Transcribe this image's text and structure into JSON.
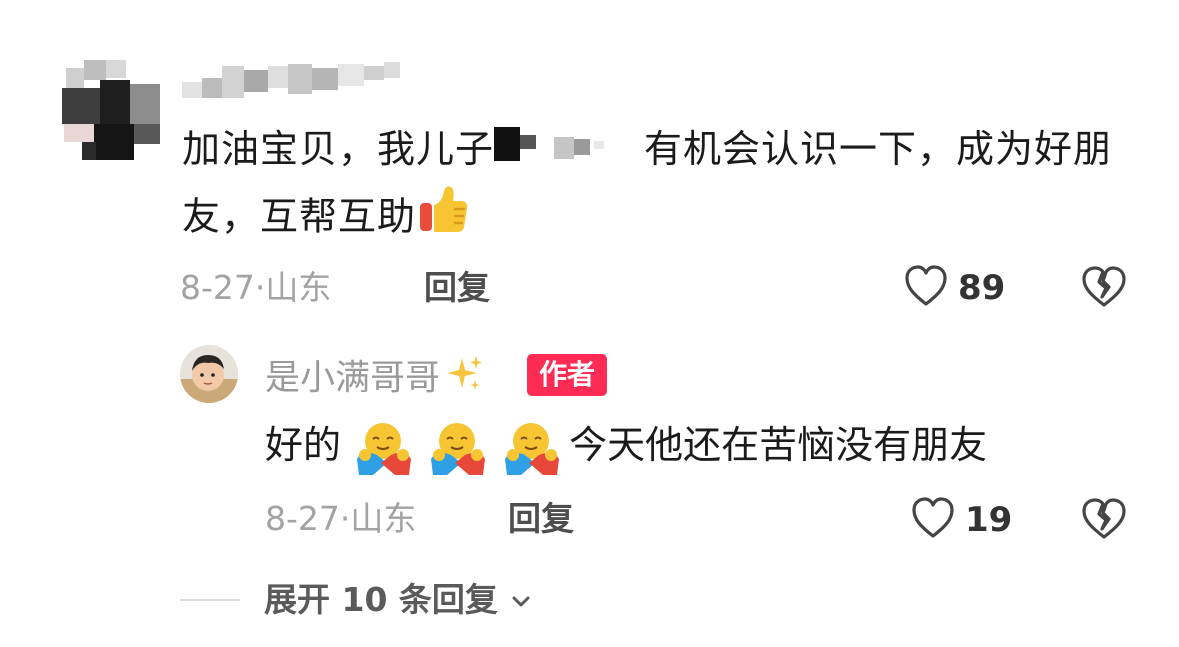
{
  "comment": {
    "text_part1": "加油宝贝，我儿子",
    "text_part2": "有机会认识一下，成为好朋友，互帮互助",
    "date": "8-27",
    "separator": "·",
    "location": "山东",
    "reply_label": "回复",
    "like_count": "89"
  },
  "reply": {
    "username": "是小满哥哥",
    "author_badge": "作者",
    "text_prefix": "好的",
    "text_suffix": "今天他还在苦恼没有朋友",
    "date": "8-27",
    "separator": "·",
    "location": "山东",
    "reply_label": "回复",
    "like_count": "19"
  },
  "expand": {
    "label": "展开 10 条回复"
  },
  "icons": {
    "like": "heart-outline-icon",
    "dislike": "broken-heart-icon",
    "thumbs_up": "thumbs-up-emoji",
    "hug": "hugging-emoji",
    "sparkles": "sparkles-emoji",
    "chevron": "chevron-down-icon"
  },
  "colors": {
    "badge": "#fe2c55",
    "meta": "#a3a3a3"
  }
}
